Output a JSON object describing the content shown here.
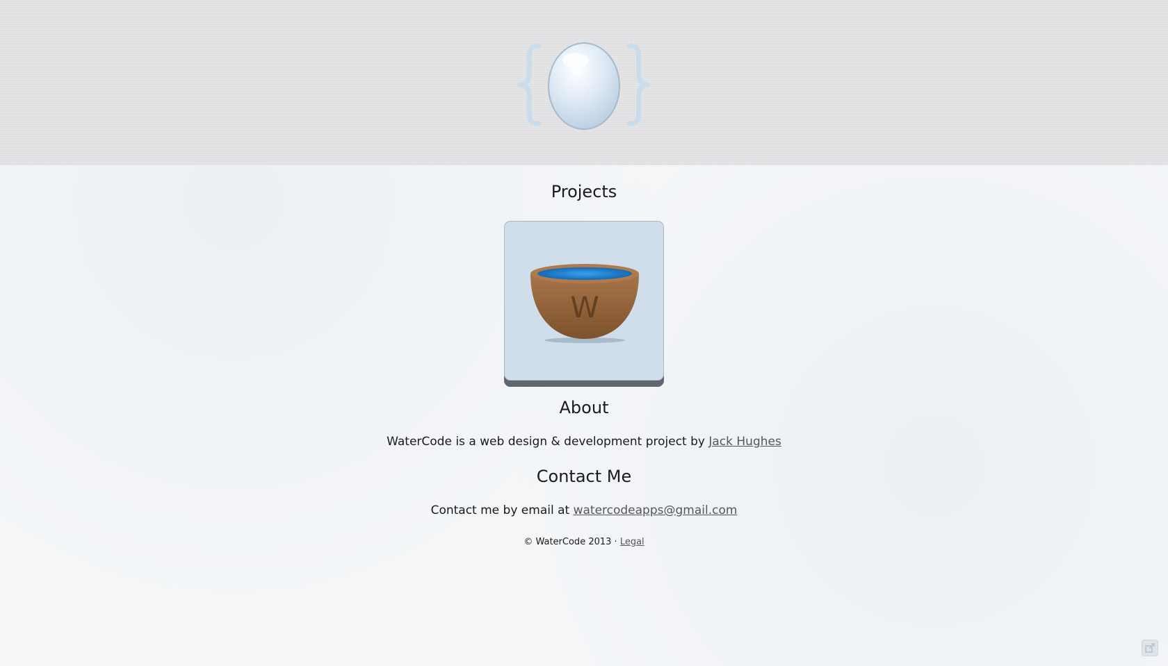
{
  "header": {
    "logo_icon": "egg-in-braces-icon"
  },
  "projects": {
    "title": "Projects",
    "items": [
      {
        "icon": "bowl-icon",
        "letter": "W"
      }
    ]
  },
  "about": {
    "title": "About",
    "text": "WaterCode is a web design & development project by ",
    "link_text": "Jack Hughes"
  },
  "contact": {
    "title": "Contact Me",
    "text": "Contact me by email at ",
    "email": "watercodeapps@gmail.com"
  },
  "footer": {
    "copyright": "© WaterCode 2013 · ",
    "legal_link": "Legal"
  },
  "share": {
    "icon": "share-icon"
  },
  "colors": {
    "header_bg": "#e2e2e4",
    "tile_bg": "#cfdeea",
    "tile_shadow": "#5f666d",
    "bowl": "#9b6a3f",
    "water": "#1b7fd1"
  }
}
